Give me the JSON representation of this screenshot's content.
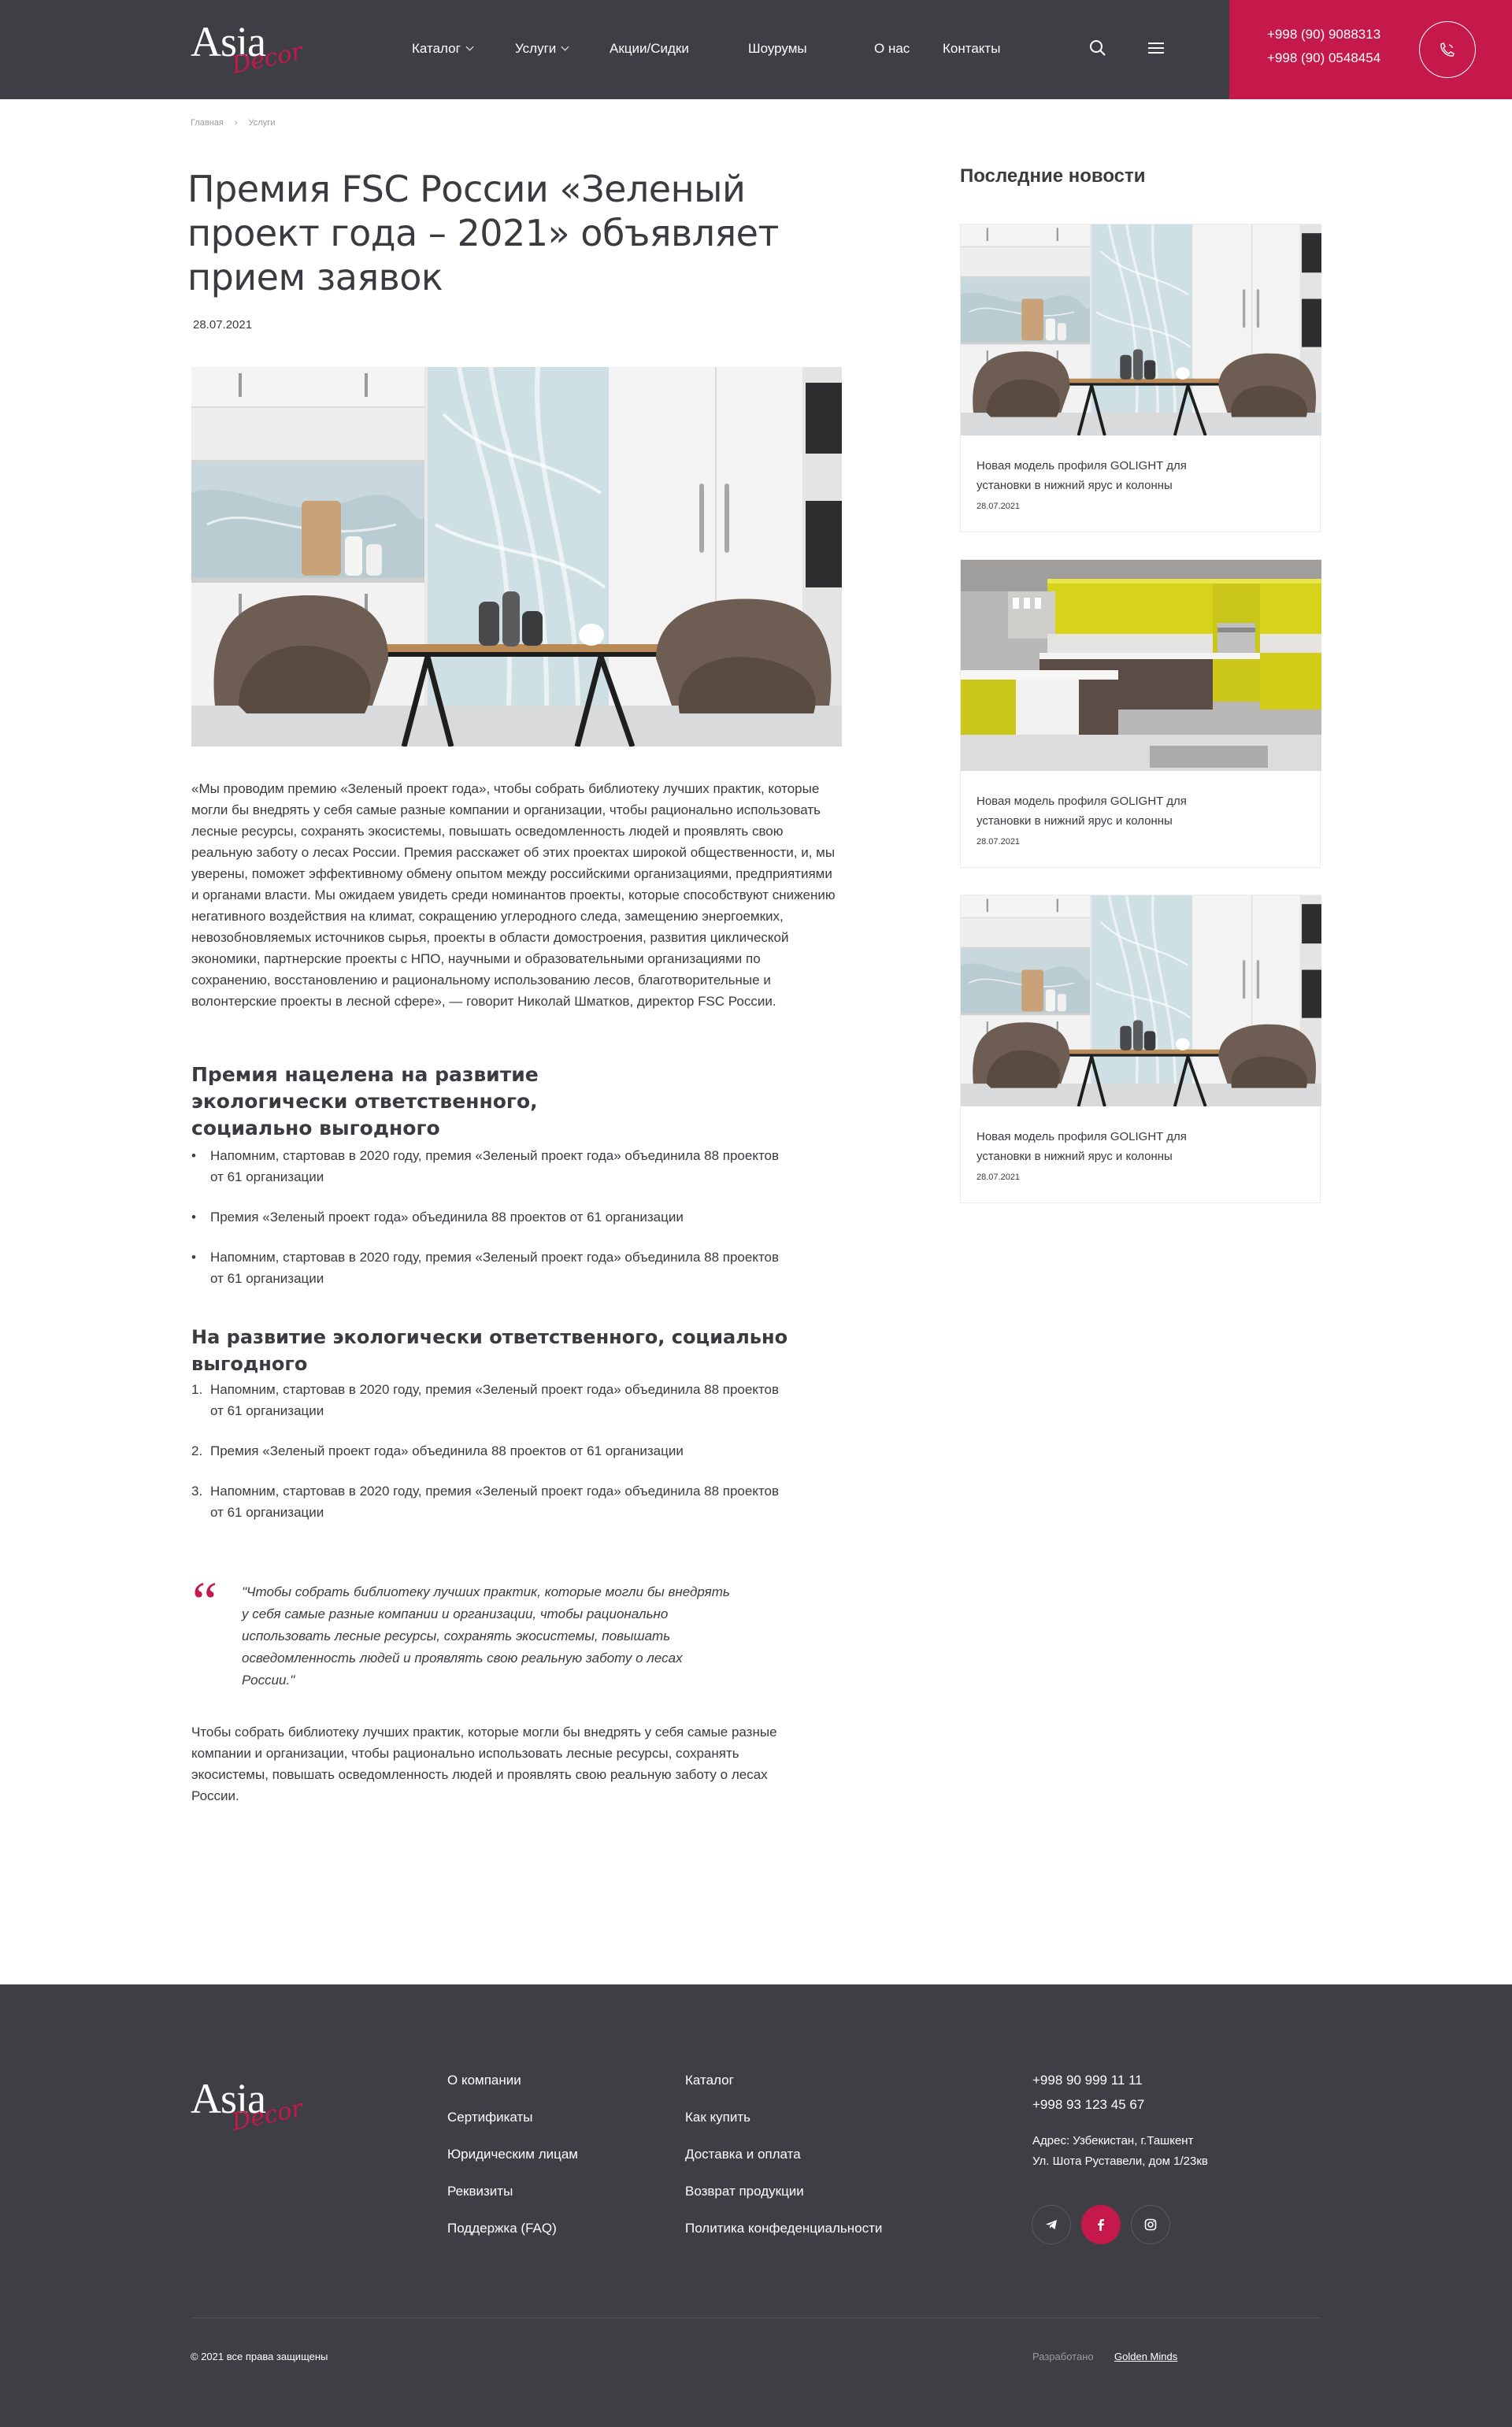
{
  "header": {
    "logo_word": "Asia",
    "logo_script": "Decor",
    "nav": [
      {
        "label": "Каталог",
        "has_dropdown": true
      },
      {
        "label": "Услуги",
        "has_dropdown": true
      },
      {
        "label": "Акции/Сидки",
        "has_dropdown": false
      },
      {
        "label": "Шоурумы",
        "has_dropdown": false
      },
      {
        "label": "О нас",
        "has_dropdown": false
      },
      {
        "label": "Контакты",
        "has_dropdown": false
      }
    ],
    "search_icon": "search-icon",
    "menu_icon": "menu-icon",
    "phones": [
      "+998 (90) 9088313",
      "+998 (90) 0548454"
    ],
    "call_icon": "phone-call-icon",
    "accent_color": "#c4194a",
    "bg_color": "#3f3e45"
  },
  "breadcrumb": [
    "Главная",
    "Услуги"
  ],
  "article": {
    "title": "Премия FSC России «Зеленый проект года – 2021» объявляет прием заявок",
    "date": "28.07.2021",
    "body": "«Мы проводим премию «Зеленый проект года», чтобы собрать библиотеку лучших практик, которые могли бы внедрять у себя самые разные компании и организации, чтобы рационально использовать лесные ресурсы, сохранять экосистемы, повышать осведомленность людей и проявлять свою реальную заботу о лесах России. Премия расскажет об этих проектах широкой общественности, и, мы уверены, поможет эффективному обмену опытом между российскими организациями, предприятиями и органами власти. Мы ожидаем увидеть среди номинантов проекты, которые способствуют снижению негативного воздействия на климат, сокращению углеродного следа, замещению энергоемких, невозобновляемых источников сырья, проекты в области домостроения, развития циклической экономики, партнерские проекты с НПО, научными и образовательными организациями по сохранению, восстановлению и рациональному использованию лесов, благотворительные и волонтерские проекты в лесной сфере», — говорит Николай Шматков, директор FSC России.",
    "subheading_1": "Премия нацелена на развитие экологически ответственного, социально выгодного",
    "bullets": [
      "Напомним, стартовав в 2020 году, премия «Зеленый проект года» объединила 88 проектов от 61 организации",
      "Премия «Зеленый проект года» объединила 88 проектов от 61 организации",
      "Напомним, стартовав в 2020 году, премия «Зеленый проект года» объединила 88 проектов от 61 организации"
    ],
    "subheading_2": "На развитие экологически ответственного, социально выгодного",
    "numbered": [
      "Напомним, стартовав в 2020 году, премия «Зеленый проект года» объединила 88 проектов от 61 организации",
      "Премия «Зеленый проект года» объединила 88 проектов от 61 организации",
      "Напомним, стартовав в 2020 году, премия «Зеленый проект года» объединила 88 проектов от 61 организации"
    ],
    "quote": "\"Чтобы собрать библиотеку лучших практик, которые могли бы внедрять у себя самые разные компании и организации, чтобы рационально использовать лесные ресурсы, сохранять экосистемы, повышать осведомленность людей и проявлять свою реальную заботу о лесах России.\"",
    "closing": "Чтобы собрать библиотеку лучших практик, которые могли бы внедрять у себя самые разные компании и организации, чтобы рационально использовать лесные ресурсы, сохранять экосистемы, повышать осведомленность людей и проявлять свою реальную заботу о лесах России."
  },
  "sidebar": {
    "title": "Последние новости",
    "cards": [
      {
        "title": "Новая модель профиля GOLIGHT для установки в нижний ярус и колонны",
        "date": "28.07.2021",
        "image": "dining-room-photo"
      },
      {
        "title": "Новая модель профиля GOLIGHT для установки в нижний ярус и колонны",
        "date": "28.07.2021",
        "image": "yellow-kitchen-photo"
      },
      {
        "title": "Новая модель профиля GOLIGHT для установки в нижний ярус и колонны",
        "date": "28.07.2021",
        "image": "dining-room-photo"
      }
    ]
  },
  "footer": {
    "logo_word": "Asia",
    "logo_script": "Decor",
    "col1": [
      "О компании",
      "Сертификаты",
      "Юридическим лицам",
      "Реквизиты",
      "Поддержка (FAQ)"
    ],
    "col2": [
      "Каталог",
      "Как купить",
      "Доставка и оплата",
      "Возврат продукции",
      "Политика конфеденциальности"
    ],
    "phones": [
      "+998 90 999 11 11",
      "+998 93 123 45 67"
    ],
    "address_1": "Адрес: Узбекистан, г.Ташкент",
    "address_2": "Ул. Шота Руставели, дом 1/23кв",
    "socials": [
      "telegram-icon",
      "facebook-icon",
      "instagram-icon"
    ],
    "copyright": "© 2021 все права защищены",
    "dev_label": "Разработано",
    "dev_name": "Golden Minds"
  }
}
